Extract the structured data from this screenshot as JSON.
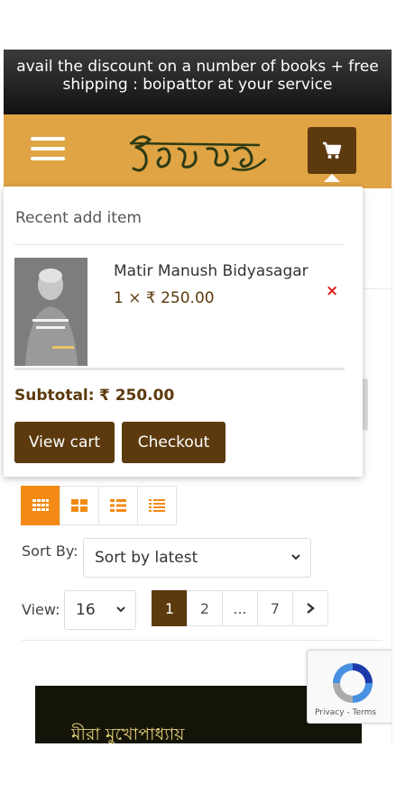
{
  "promo": {
    "line1": "avail the discount on a number of books + free",
    "line2": "shipping : boipattor at your service"
  },
  "header": {
    "logo_text": "বইপত্তর",
    "menu_icon": "hamburger-icon",
    "cart_icon": "cart-icon"
  },
  "colors": {
    "header": "#e0a444",
    "brand_brown": "#5c3a0e",
    "accent_orange": "#f28a14",
    "remove_red": "#e02020"
  },
  "cart_dropdown": {
    "title": "Recent add item",
    "item": {
      "name": "Matir Manush Bidyasagar",
      "qty_price": "1 × ₹ 250.00",
      "thumb_text": "মাটির মানুষ বিদ্যাসাগর"
    },
    "remove_symbol": "×",
    "subtotal_label": "Subtotal:",
    "subtotal_value": "₹ 250.00",
    "view_cart_label": "View cart",
    "checkout_label": "Checkout"
  },
  "toolbar": {
    "view_modes": [
      "grid-small-icon",
      "grid-large-icon",
      "list-icon",
      "list-compact-icon"
    ],
    "sort_label": "Sort By:",
    "sort_value": "Sort by latest",
    "view_label": "View:",
    "view_value": "16",
    "pages": [
      "1",
      "2",
      "...",
      "7"
    ],
    "current_page": "1",
    "next_icon": "chevron-right-icon"
  },
  "product_preview": {
    "title": "মীরা মুখোপাধ্যায়"
  },
  "recaptcha": {
    "links": "Privacy - Terms"
  }
}
